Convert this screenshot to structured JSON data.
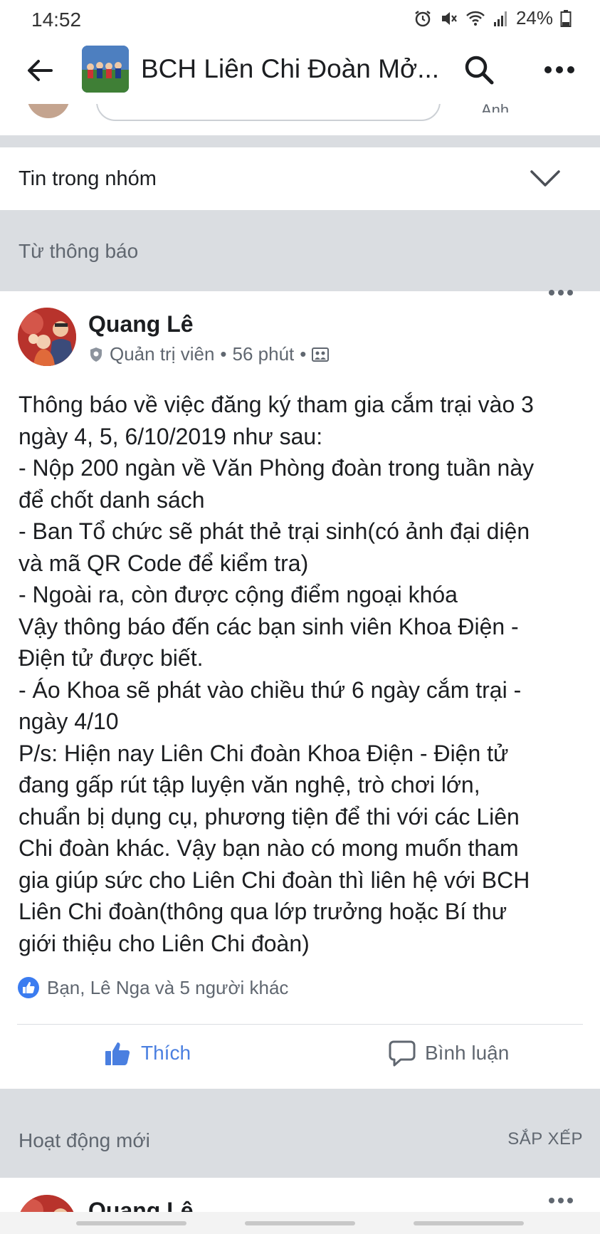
{
  "status_bar": {
    "time": "14:52",
    "battery": "24%",
    "icons": [
      "alarm-icon",
      "mute-icon",
      "wifi-icon",
      "signal-icon",
      "battery-icon"
    ]
  },
  "app_bar": {
    "title": "BCH Liên Chi Đoàn Mở...",
    "icons": [
      "back-arrow-icon",
      "search-icon",
      "more-icon"
    ]
  },
  "composer_strip": {
    "partial_label": "Ảnh"
  },
  "news_section": {
    "label": "Tin trong nhóm"
  },
  "announcements": {
    "label": "Từ thông báo"
  },
  "post": {
    "author": "Quang Lê",
    "role": "Quản trị viên",
    "time": "56 phút",
    "body_lines": [
      "Thông báo về việc đăng ký tham gia cắm trại vào 3",
      "ngày 4, 5, 6/10/2019 như sau:",
      "- Nộp 200 ngàn về Văn Phòng đoàn trong tuần này",
      "để chốt danh sách",
      "- Ban Tổ chức sẽ phát thẻ trại sinh(có ảnh đại diện",
      "và mã QR Code để kiểm tra)",
      "- Ngoài ra, còn được cộng điểm ngoại khóa",
      "Vậy thông báo đến các bạn sinh viên Khoa Điện -",
      "Điện tử được biết.",
      "- Áo Khoa sẽ phát vào chiều thứ 6 ngày cắm trại -",
      "ngày 4/10",
      "P/s: Hiện nay Liên Chi đoàn Khoa Điện - Điện tử",
      "đang gấp rút tập luyện văn nghệ, trò chơi lớn,",
      "chuẩn bị dụng cụ, phương tiện để thi với các Liên",
      "Chi đoàn khác. Vậy bạn nào có mong muốn tham",
      "gia giúp sức cho Liên Chi đoàn thì liên hệ với BCH",
      "Liên Chi đoàn(thông qua lớp trưởng hoặc Bí thư",
      "giới thiệu cho Liên Chi đoàn)"
    ],
    "reactions": "Bạn, Lê Nga và 5 người khác",
    "like_label": "Thích",
    "comment_label": "Bình luận"
  },
  "activity": {
    "label": "Hoạt động mới",
    "sort_label": "SẮP XẾP"
  },
  "next_post": {
    "author": "Quang Lê"
  },
  "colors": {
    "like_blue": "#4a7fe0",
    "separator_gray": "#dadde1",
    "secondary_text": "#606770"
  }
}
